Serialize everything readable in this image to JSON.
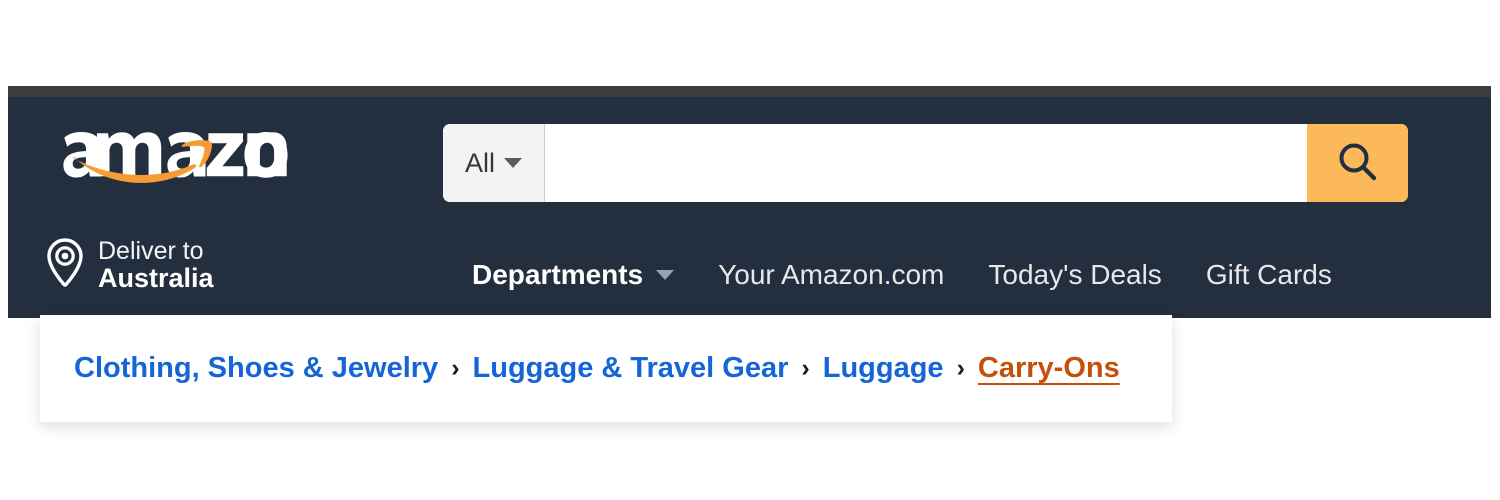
{
  "colors": {
    "header_bg": "#232f3e",
    "header_top_strip": "#3a3d40",
    "search_button_bg": "#fcb95a",
    "logo_swoosh": "#f79c34",
    "breadcrumb_link": "#1565d8",
    "breadcrumb_current": "#c4500b",
    "panel_bg": "#ffffff",
    "scope_bg": "#f3f3f3"
  },
  "header": {
    "logo_text": "amazon",
    "logo_icon": "amazon-logo",
    "search": {
      "scope_label": "All",
      "scope_icon": "chevron-down-icon",
      "value": "",
      "placeholder": "",
      "submit_icon": "search-icon"
    },
    "deliver_to": {
      "icon": "location-pin-icon",
      "label": "Deliver to",
      "country": "Australia"
    },
    "nav": [
      {
        "label": "Departments",
        "bold": true,
        "has_chevron": true
      },
      {
        "label": "Your Amazon.com",
        "bold": false,
        "has_chevron": false
      },
      {
        "label": "Today's Deals",
        "bold": false,
        "has_chevron": false
      },
      {
        "label": "Gift Cards",
        "bold": false,
        "has_chevron": false
      }
    ]
  },
  "breadcrumb": {
    "separator": "›",
    "items": [
      {
        "label": "Clothing, Shoes & Jewelry",
        "current": false
      },
      {
        "label": "Luggage & Travel Gear",
        "current": false
      },
      {
        "label": "Luggage",
        "current": false
      },
      {
        "label": "Carry-Ons",
        "current": true
      }
    ]
  }
}
